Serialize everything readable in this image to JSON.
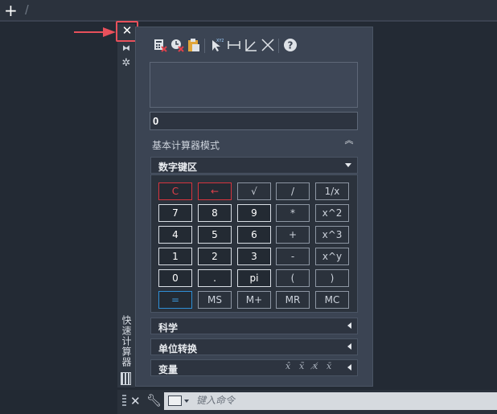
{
  "topbar": {
    "plus": "+",
    "slash": "/"
  },
  "palette": {
    "close": "✕",
    "vertical_title": "快速计算器",
    "display_value": "0",
    "mode_label": "基本计算器模式"
  },
  "sections": {
    "keypad_title": "数字键区",
    "science_title": "科学",
    "units_title": "单位转换",
    "variables_title": "变量"
  },
  "keypad": {
    "rows": [
      [
        {
          "label": "C",
          "style": "red"
        },
        {
          "label": "←",
          "style": "red"
        },
        {
          "label": "√",
          "style": "dim"
        },
        {
          "label": "/",
          "style": "dim"
        },
        {
          "label": "1/x",
          "style": "dim"
        }
      ],
      [
        {
          "label": "7",
          "style": ""
        },
        {
          "label": "8",
          "style": ""
        },
        {
          "label": "9",
          "style": ""
        },
        {
          "label": "*",
          "style": "dim"
        },
        {
          "label": "x^2",
          "style": "dim"
        }
      ],
      [
        {
          "label": "4",
          "style": ""
        },
        {
          "label": "5",
          "style": ""
        },
        {
          "label": "6",
          "style": ""
        },
        {
          "label": "+",
          "style": "dim"
        },
        {
          "label": "x^3",
          "style": "dim"
        }
      ],
      [
        {
          "label": "1",
          "style": ""
        },
        {
          "label": "2",
          "style": ""
        },
        {
          "label": "3",
          "style": ""
        },
        {
          "label": "-",
          "style": "dim"
        },
        {
          "label": "x^y",
          "style": "dim"
        }
      ],
      [
        {
          "label": "0",
          "style": ""
        },
        {
          "label": ".",
          "style": ""
        },
        {
          "label": "pi",
          "style": ""
        },
        {
          "label": "(",
          "style": "dim"
        },
        {
          "label": ")",
          "style": "dim"
        }
      ],
      [
        {
          "label": "=",
          "style": "blue"
        },
        {
          "label": "MS",
          "style": "dim"
        },
        {
          "label": "M+",
          "style": "dim"
        },
        {
          "label": "MR",
          "style": "dim"
        },
        {
          "label": "MC",
          "style": "dim"
        }
      ]
    ]
  },
  "commandline": {
    "close": "✕",
    "placeholder": "键入命令"
  },
  "colors": {
    "background": "#222933",
    "panel": "#3b4453",
    "highlight_red": "#e8505b",
    "key_red": "#d6343e",
    "key_blue": "#2f8fd6"
  }
}
